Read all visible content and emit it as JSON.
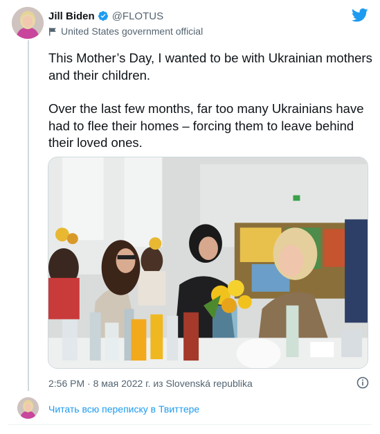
{
  "author": {
    "display_name": "Jill Biden",
    "handle": "@FLOTUS",
    "label": "United States government official"
  },
  "tweet": {
    "paragraphs": [
      "This Mother’s Day, I wanted to be with Ukrainian mothers and their children.",
      "Over the last few months, far too many Ukrainians have had to flee their homes – forcing them to leave behind their loved ones."
    ],
    "timestamp_line": "2:56 PM · 8 мая 2022 г. из Slovenská republika"
  },
  "footer": {
    "read_thread": "Читать всю переписку в Твиттере"
  },
  "icons": {
    "verified": "verified-badge-icon",
    "government_label": "flag-icon",
    "brand": "twitter-bird-icon",
    "info": "info-circle-icon"
  },
  "colors": {
    "brand_blue": "#1d9bf0",
    "verified_blue": "#1d9bf0",
    "text_primary": "#0f1419",
    "text_secondary": "#536471",
    "divider": "#cfd9de"
  }
}
